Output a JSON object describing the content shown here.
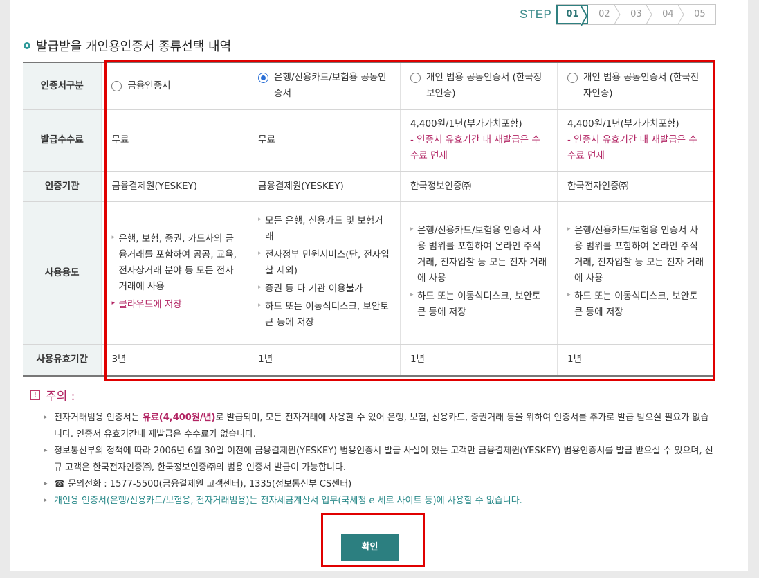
{
  "steps": {
    "label": "STEP",
    "items": [
      "01",
      "02",
      "03",
      "04",
      "05"
    ],
    "active_index": 0
  },
  "title": "발급받을 개인용인증서 종류선택 내역",
  "table": {
    "row_headers": [
      "인증서구분",
      "발급수수료",
      "인증기관",
      "사용용도",
      "사용유효기간"
    ],
    "columns": [
      {
        "name": "금융인증서",
        "selected": false,
        "fee": "무료",
        "fee_note": "",
        "authority": "금융결제원(YESKEY)",
        "uses": [
          "은행, 보험, 증권, 카드사의 금융거래를 포함하여 공공, 교육, 전자상거래 분야 등 모든 전자거래에 사용"
        ],
        "uses_highlight": "클라우드에 저장",
        "validity": "3년"
      },
      {
        "name": "은행/신용카드/보험용 공동인증서",
        "selected": true,
        "fee": "무료",
        "fee_note": "",
        "authority": "금융결제원(YESKEY)",
        "uses": [
          "모든 은행, 신용카드 및 보험거래",
          "전자정부 민원서비스(단, 전자입찰 제외)",
          "증권 등 타 기관 이용불가",
          "하드 또는 이동식디스크, 보안토큰 등에 저장"
        ],
        "uses_highlight": "",
        "validity": "1년"
      },
      {
        "name": "개인 범용 공동인증서 (한국정보인증)",
        "selected": false,
        "fee": "4,400원/1년(부가가치포함)",
        "fee_note": "- 인증서 유효기간 내 재발급은 수수료 면제",
        "authority": "한국정보인증㈜",
        "uses": [
          "은행/신용카드/보험용 인증서 사용 범위를 포함하여 온라인 주식거래, 전자입찰 등 모든 전자 거래에 사용",
          "하드 또는 이동식디스크, 보안토큰 등에 저장"
        ],
        "uses_highlight": "",
        "validity": "1년"
      },
      {
        "name": "개인 범용 공동인증서 (한국전자인증)",
        "selected": false,
        "fee": "4,400원/1년(부가가치포함)",
        "fee_note": "- 인증서 유효기간 내 재발급은 수수료 면제",
        "authority": "한국전자인증㈜",
        "uses": [
          "은행/신용카드/보험용 인증서 사용 범위를 포함하여 온라인 주식거래, 전자입찰 등 모든 전자 거래에 사용",
          "하드 또는 이동식디스크, 보안토큰 등에 저장"
        ],
        "uses_highlight": "",
        "validity": "1년"
      }
    ]
  },
  "notice": {
    "heading": "주의 :",
    "p1_pre": "전자거래범용 인증서는 ",
    "p1_emph": "유료(4,400원/년)",
    "p1_post": "로 발급되며, 모든 전자거래에 사용할 수 있어 은행, 보험, 신용카드, 증권거래 등을 위하여 인증서를 추가로 발급 받으실 필요가 없습니다. 인증서 유효기간내 재발급은 수수료가 없습니다.",
    "p2": "정보통신부의 정책에 따라 2006년 6월 30일 이전에 금융결제원(YESKEY) 범용인증서 발급 사실이 있는 고객만 금융결제원(YESKEY) 범용인증서를 발급 받으실 수 있으며, 신규 고객은 한국전자인증㈜, 한국정보인증㈜의 범용 인증서 발급이 가능합니다.",
    "p3": "☎ 문의전화 : 1577-5500(금융결제원 고객센터), 1335(정보통신부 CS센터)",
    "p4": "개인용 인증서(은행/신용카드/보험용, 전자거래범용)는 전자세금계산서 업무(국세청 e 세로 사이트 등)에 사용할 수 없습니다."
  },
  "confirm_button": "확인",
  "colors": {
    "accent": "#2c7f80",
    "emphasis": "#b22463",
    "highlight_box": "#e00000"
  }
}
